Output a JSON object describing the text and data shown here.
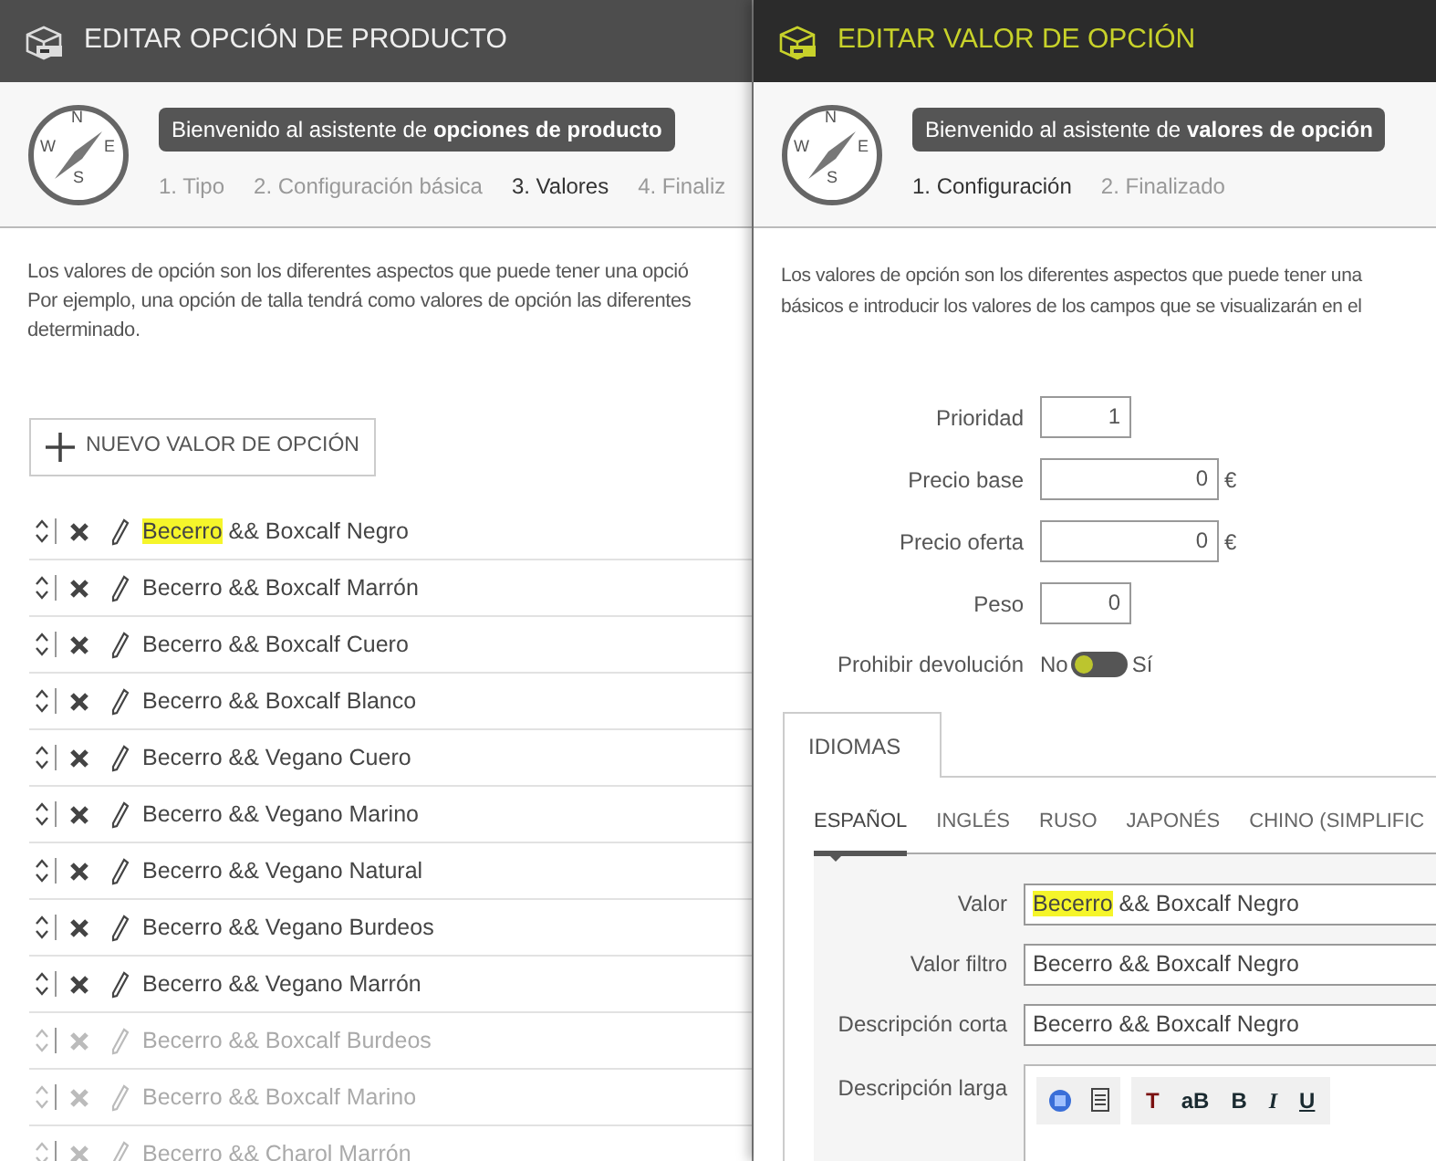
{
  "left_window": {
    "title": "EDITAR OPCIÓN DE PRODUCTO",
    "wizard": {
      "compass_letters": [
        "N",
        "E",
        "S",
        "W"
      ],
      "welcome": "Bienvenido al asistente de **opciones de producto**",
      "steps": [
        {
          "label": "1. Tipo",
          "selected": false
        },
        {
          "label": "2. Configuración básica",
          "selected": false
        },
        {
          "label": "3. Valores",
          "selected": true
        },
        {
          "label": "4. Finaliz",
          "selected": false
        }
      ]
    },
    "description": [
      "Los valores de opción son los diferentes aspectos que puede tener una opció",
      "Por ejemplo, una opción de talla tendrá como valores de opción las diferentes",
      "determinado."
    ],
    "new_button": "NUEVO VALOR DE OPCIÓN",
    "values": [
      {
        "highlight": "Becerro",
        "text": " && Boxcalf Negro",
        "disabled": false
      },
      {
        "text": "Becerro && Boxcalf Marrón",
        "disabled": false
      },
      {
        "text": "Becerro && Boxcalf Cuero",
        "disabled": false
      },
      {
        "text": "Becerro && Boxcalf Blanco",
        "disabled": false
      },
      {
        "text": "Becerro && Vegano Cuero",
        "disabled": false
      },
      {
        "text": "Becerro && Vegano Marino",
        "disabled": false
      },
      {
        "text": "Becerro && Vegano Natural",
        "disabled": false
      },
      {
        "text": "Becerro && Vegano Burdeos",
        "disabled": false
      },
      {
        "text": "Becerro && Vegano Marrón",
        "disabled": false
      },
      {
        "text": "Becerro && Boxcalf Burdeos",
        "disabled": true
      },
      {
        "text": "Becerro && Boxcalf Marino",
        "disabled": true
      },
      {
        "text": "Becerro && Charol Marrón",
        "disabled": true
      }
    ]
  },
  "right_window": {
    "title": "EDITAR VALOR DE OPCIÓN",
    "wizard": {
      "compass_letters": [
        "N",
        "E",
        "S",
        "W"
      ],
      "welcome": "Bienvenido al asistente de **valores de opción**",
      "steps": [
        {
          "label": "1. Configuración",
          "selected": true
        },
        {
          "label": "2. Finalizado",
          "selected": false
        }
      ]
    },
    "description": [
      "Los valores de opción son los diferentes aspectos que puede tener una",
      "básicos e introducir los valores de los campos que se visualizarán en el"
    ],
    "fields": [
      {
        "label": "Prioridad",
        "value": "1",
        "kind": "short"
      },
      {
        "label": "Precio base",
        "value": "0",
        "kind": "money",
        "unit": "€"
      },
      {
        "label": "Precio oferta",
        "value": "0",
        "kind": "money",
        "unit": "€"
      },
      {
        "label": "Peso",
        "value": "0",
        "kind": "short"
      }
    ],
    "toggle": {
      "label": "Prohibir devolución",
      "off_label": "No",
      "on_label": "Sí",
      "on": false
    },
    "section_tab": "IDIOMAS",
    "language_tabs": [
      {
        "label": "ESPAÑOL",
        "selected": true
      },
      {
        "label": "INGLÉS",
        "selected": false
      },
      {
        "label": "RUSO",
        "selected": false
      },
      {
        "label": "JAPONÉS",
        "selected": false
      },
      {
        "label": "CHINO (SIMPLIFIC",
        "selected": false
      }
    ],
    "text_fields": [
      {
        "label": "Valor",
        "highlight": "Becerro",
        "value": " && Boxcalf Negro"
      },
      {
        "label": "Valor filtro",
        "value": "Becerro && Boxcalf Negro"
      },
      {
        "label": "Descripción corta",
        "value": "Becerro && Boxcalf Negro"
      }
    ],
    "long_description": {
      "label": "Descripción larga",
      "toolbar": [
        "T",
        "aB",
        "B",
        "I",
        "U"
      ]
    }
  }
}
